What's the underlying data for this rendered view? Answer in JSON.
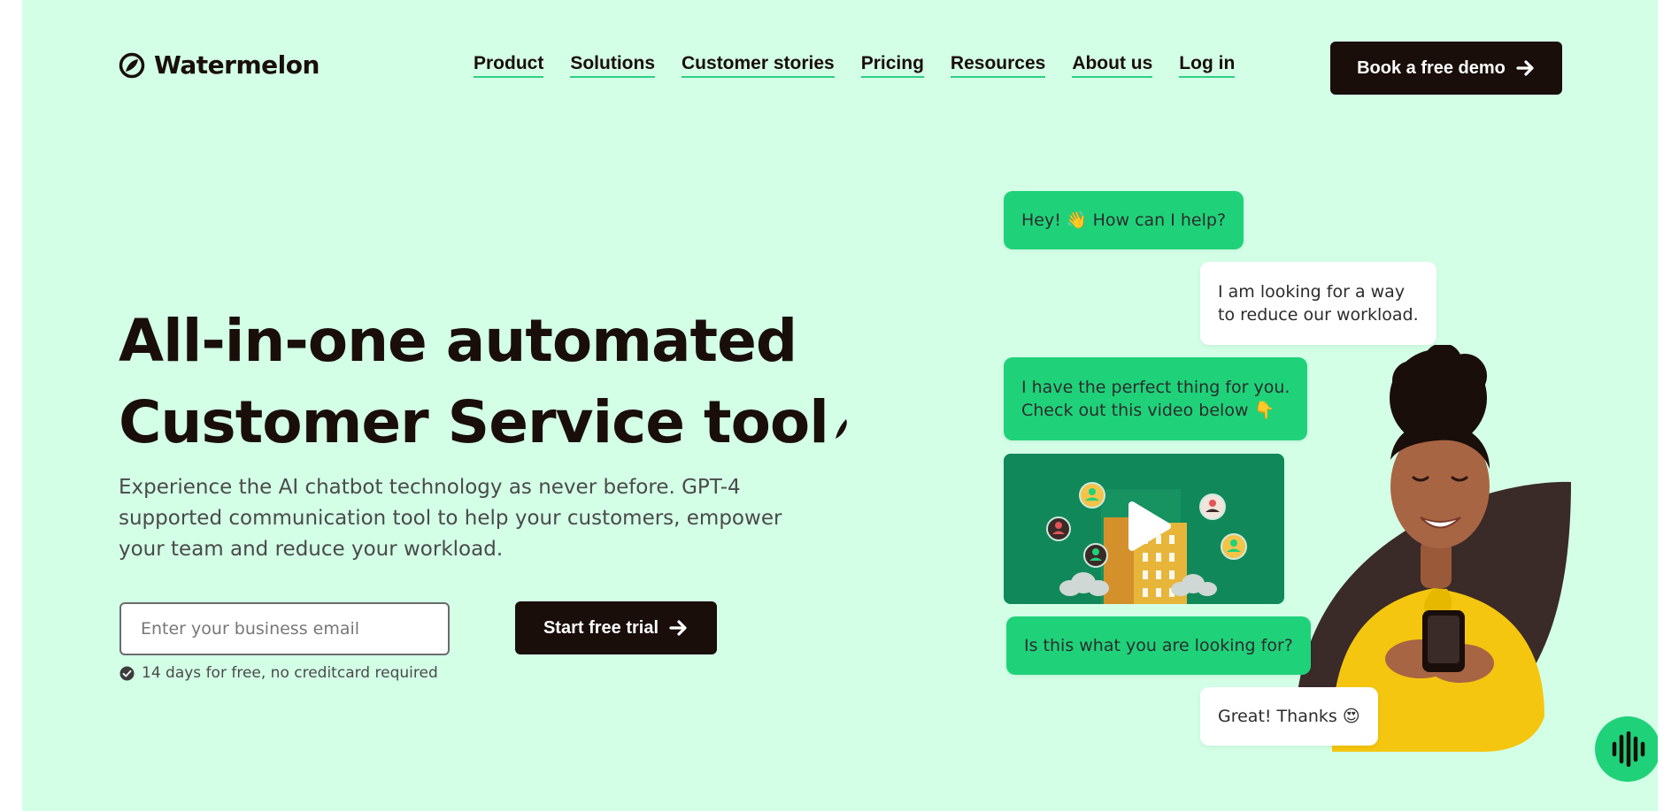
{
  "brand": {
    "name": "Watermelon"
  },
  "nav": {
    "items": [
      "Product",
      "Solutions",
      "Customer stories",
      "Pricing",
      "Resources",
      "About us",
      "Log in"
    ]
  },
  "header": {
    "demo_label": "Book a free demo"
  },
  "hero": {
    "title_line1": "All-in-one automated",
    "title_line2": "Customer Service tool",
    "subtitle": "Experience the AI chatbot technology as never before. GPT-4 supported communication tool to help your customers, empower your team and reduce your workload.",
    "email_placeholder": "Enter your business email",
    "cta_label": "Start free trial",
    "note": "14 days for free, no creditcard required"
  },
  "chat": {
    "messages": [
      {
        "text": "Hey! 👋 How can I help?",
        "from": "bot"
      },
      {
        "text_line1": "I am looking for a way",
        "text_line2": "to reduce our workload.",
        "from": "user"
      },
      {
        "text_line1": "I have the perfect thing for you.",
        "text_line2": "Check out this video below 👇",
        "from": "bot"
      },
      {
        "text": "Is this what you are looking for?",
        "from": "bot"
      },
      {
        "text": "Great! Thanks 😍",
        "from": "user"
      }
    ]
  },
  "icons": {
    "logo": "watermelon-logo-icon",
    "arrow": "arrow-right-icon",
    "check": "check-badge-icon",
    "play": "play-icon",
    "voice": "voice-wave-icon"
  },
  "colors": {
    "background": "#d3ffe7",
    "accent": "#1fd27a",
    "dark": "#1a0e0a",
    "person_sweater": "#f5c60f"
  }
}
